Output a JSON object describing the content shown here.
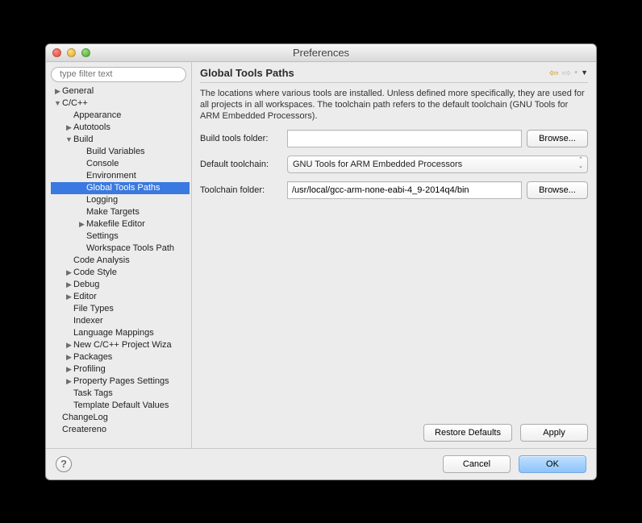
{
  "window": {
    "title": "Preferences"
  },
  "filter": {
    "placeholder": "type filter text"
  },
  "tree": {
    "n_general": "General",
    "n_cpp": "C/C++",
    "n_appearance": "Appearance",
    "n_autotools": "Autotools",
    "n_build": "Build",
    "n_buildvars": "Build Variables",
    "n_console": "Console",
    "n_env": "Environment",
    "n_gtp": "Global Tools Paths",
    "n_logging": "Logging",
    "n_maketargets": "Make Targets",
    "n_makefile": "Makefile Editor",
    "n_settings": "Settings",
    "n_wtp": "Workspace Tools Path",
    "n_codeanalysis": "Code Analysis",
    "n_codestyle": "Code Style",
    "n_debug": "Debug",
    "n_editor": "Editor",
    "n_filetypes": "File Types",
    "n_indexer": "Indexer",
    "n_langmap": "Language Mappings",
    "n_newproj": "New C/C++ Project Wiza",
    "n_packages": "Packages",
    "n_profiling": "Profiling",
    "n_proppages": "Property Pages Settings",
    "n_tasktags": "Task Tags",
    "n_template": "Template Default Values",
    "n_changelog": "ChangeLog",
    "n_createreno": "Createreno"
  },
  "page": {
    "title": "Global Tools Paths",
    "description": "The locations where various tools are installed. Unless defined more specifically, they are used for all projects in all workspaces. The toolchain path refers to the default toolchain (GNU Tools for ARM Embedded Processors).",
    "buildtools_label": "Build tools folder:",
    "buildtools_value": "",
    "default_toolchain_label": "Default toolchain:",
    "default_toolchain_value": "GNU Tools for ARM Embedded Processors",
    "toolchain_folder_label": "Toolchain folder:",
    "toolchain_folder_value": "/usr/local/gcc-arm-none-eabi-4_9-2014q4/bin",
    "browse": "Browse...",
    "restore": "Restore Defaults",
    "apply": "Apply"
  },
  "footer": {
    "cancel": "Cancel",
    "ok": "OK",
    "help": "?"
  }
}
